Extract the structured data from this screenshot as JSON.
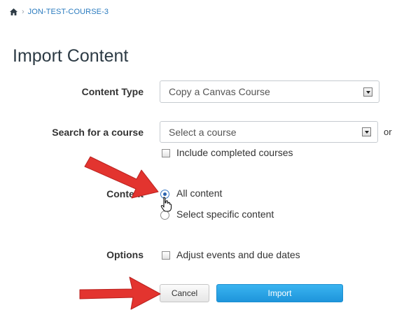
{
  "breadcrumb": {
    "home_icon": "home-icon",
    "course": "JON-TEST-COURSE-3"
  },
  "page_title": "Import Content",
  "form": {
    "content_type": {
      "label": "Content Type",
      "selected": "Copy a Canvas Course"
    },
    "search_course": {
      "label": "Search for a course",
      "selected": "Select a course",
      "trailing_text": "or",
      "include_completed_label": "Include completed courses",
      "include_completed_checked": false
    },
    "content": {
      "label": "Content",
      "options": [
        {
          "label": "All content",
          "selected": true
        },
        {
          "label": "Select specific content",
          "selected": false
        }
      ]
    },
    "options": {
      "label": "Options",
      "adjust_dates_label": "Adjust events and due dates",
      "adjust_dates_checked": false
    }
  },
  "buttons": {
    "cancel": "Cancel",
    "import": "Import"
  },
  "colors": {
    "link": "#2a7bbf",
    "title": "#2d3b45",
    "primary_button": "#1e95db",
    "annotation_arrow": "#e3342f"
  },
  "icons": [
    "home-icon",
    "chevron-right-icon",
    "dropdown-arrow-icon",
    "hand-cursor-icon",
    "red-arrow-icon"
  ]
}
